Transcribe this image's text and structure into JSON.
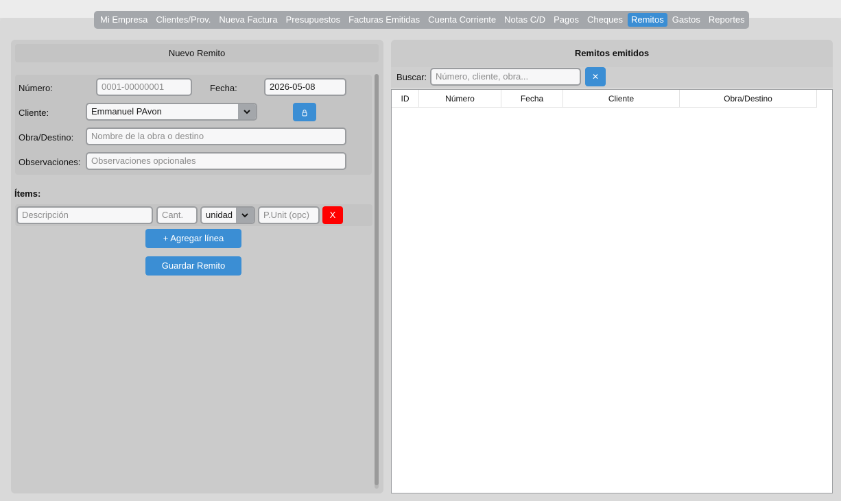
{
  "nav": {
    "tabs": [
      {
        "label": "Mi Empresa"
      },
      {
        "label": "Clientes/Prov."
      },
      {
        "label": "Nueva Factura"
      },
      {
        "label": "Presupuestos"
      },
      {
        "label": "Facturas Emitidas"
      },
      {
        "label": "Cuenta Corriente"
      },
      {
        "label": "Notas C/D"
      },
      {
        "label": "Pagos"
      },
      {
        "label": "Cheques"
      },
      {
        "label": "Remitos"
      },
      {
        "label": "Gastos"
      },
      {
        "label": "Reportes"
      }
    ],
    "active_tab": "Remitos",
    "active_color": "#3b8ed4"
  },
  "left": {
    "header": "Nuevo Remito",
    "numero_label": "Número:",
    "numero_placeholder": "0001-00000001",
    "fecha_label": "Fecha:",
    "fecha_value": "2026-05-08",
    "cliente_label": "Cliente:",
    "cliente_value": "Emmanuel PAvon",
    "refresh_icon": "refresh-icon",
    "obra_label": "Obra/Destino:",
    "obra_placeholder": "Nombre de la obra o destino",
    "obs_label": "Observaciones:",
    "obs_placeholder": "Observaciones opcionales",
    "items_label": "Ítems:",
    "item": {
      "desc_placeholder": "Descripción",
      "cant_placeholder": "Cant.",
      "unit_value": "unidad",
      "punit_placeholder": "P.Unit (opc)",
      "remove_label": "X"
    },
    "add_line_label": "+ Agregar línea",
    "save_label": "Guardar Remito"
  },
  "right": {
    "title": "Remitos emitidos",
    "search_label": "Buscar:",
    "search_placeholder": "Número, cliente, obra...",
    "clear_label": "✕",
    "columns": [
      "ID",
      "Número",
      "Fecha",
      "Cliente",
      "Obra/Destino"
    ],
    "rows": []
  }
}
